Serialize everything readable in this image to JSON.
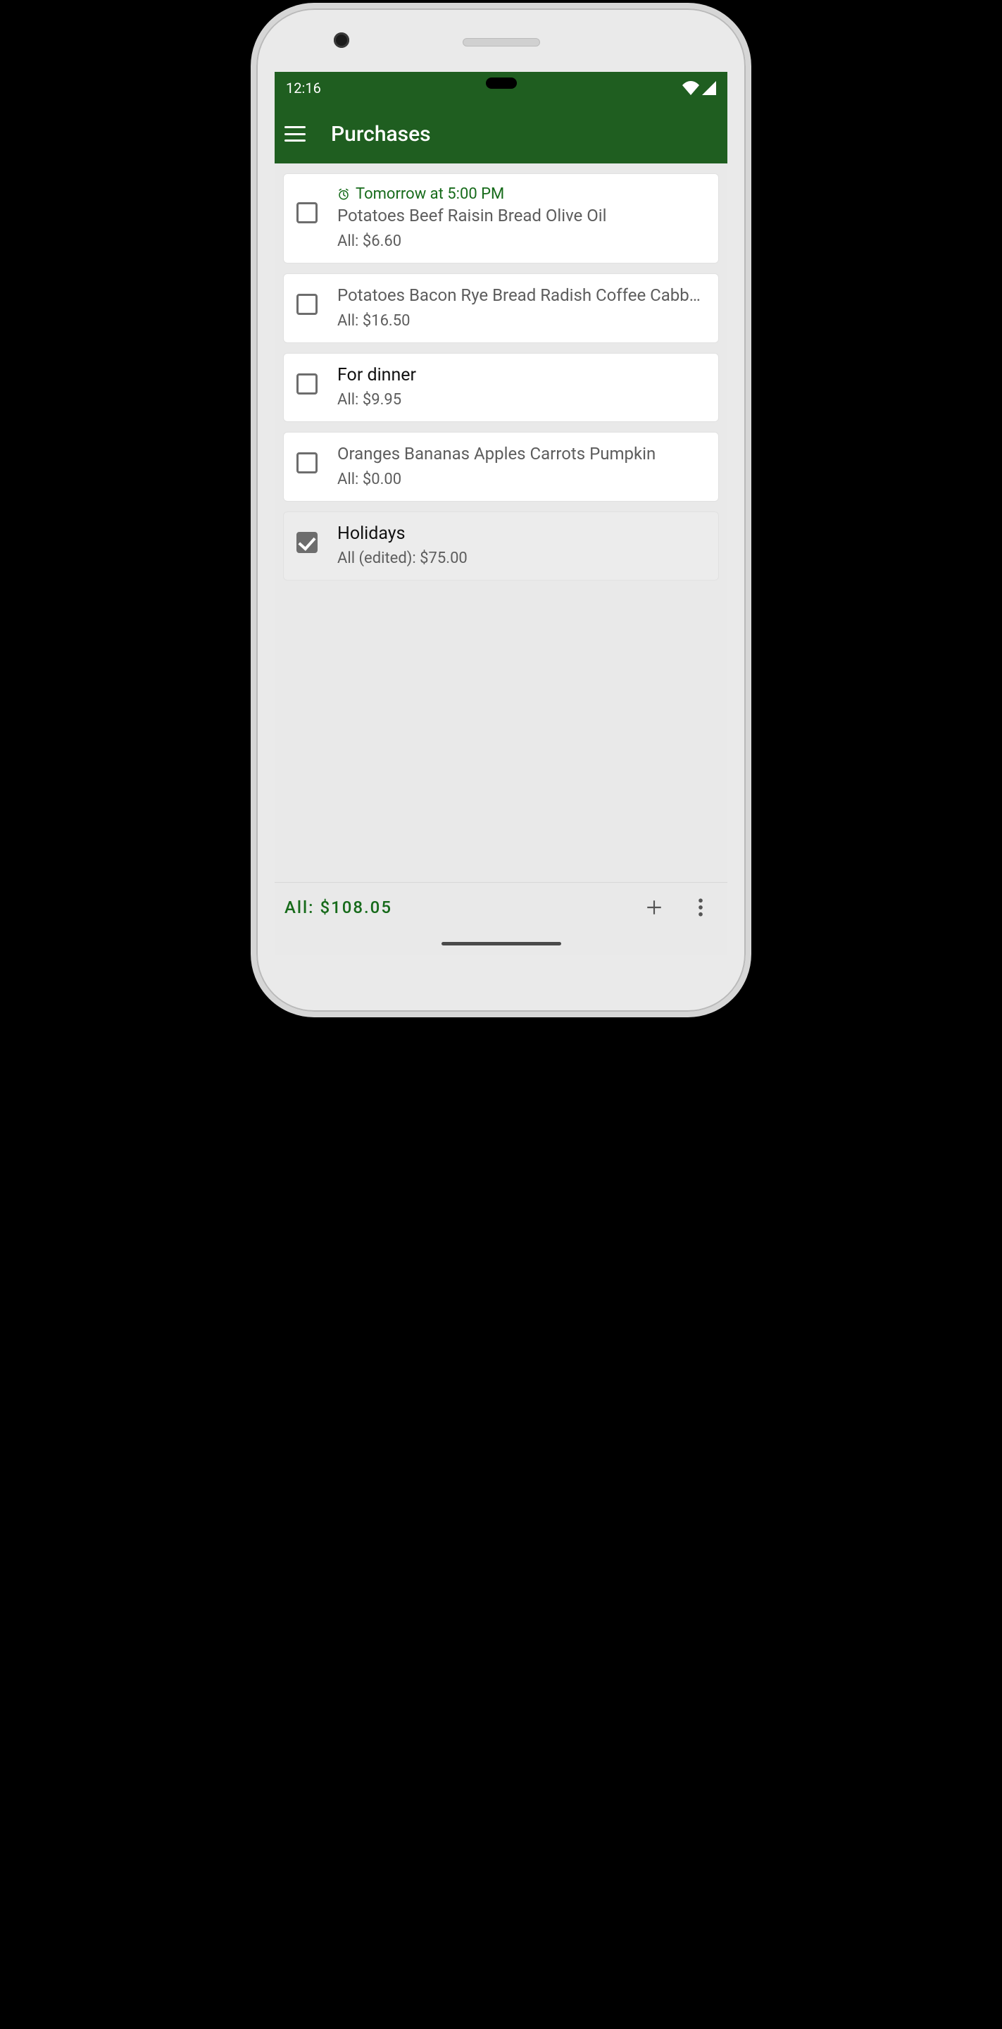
{
  "status": {
    "time": "12:16"
  },
  "appbar": {
    "title": "Purchases"
  },
  "items": [
    {
      "reminder": "Tomorrow at 5:00 PM",
      "title": "Potatoes Beef Raisin Bread Olive Oil",
      "title_dark": false,
      "subtotal": "All: $6.60",
      "checked": false
    },
    {
      "reminder": "",
      "title": "Potatoes Bacon Rye Bread Radish Coffee Cabbage …",
      "title_dark": false,
      "subtotal": "All: $16.50",
      "checked": false
    },
    {
      "reminder": "",
      "title": "For dinner",
      "title_dark": true,
      "subtotal": "All: $9.95",
      "checked": false
    },
    {
      "reminder": "",
      "title": "Oranges Bananas Apples Carrots Pumpkin",
      "title_dark": false,
      "subtotal": "All: $0.00",
      "checked": false
    },
    {
      "reminder": "",
      "title": "Holidays",
      "title_dark": true,
      "subtotal": "All (edited): $75.00",
      "checked": true
    }
  ],
  "footer": {
    "total": "All: $108.05"
  }
}
